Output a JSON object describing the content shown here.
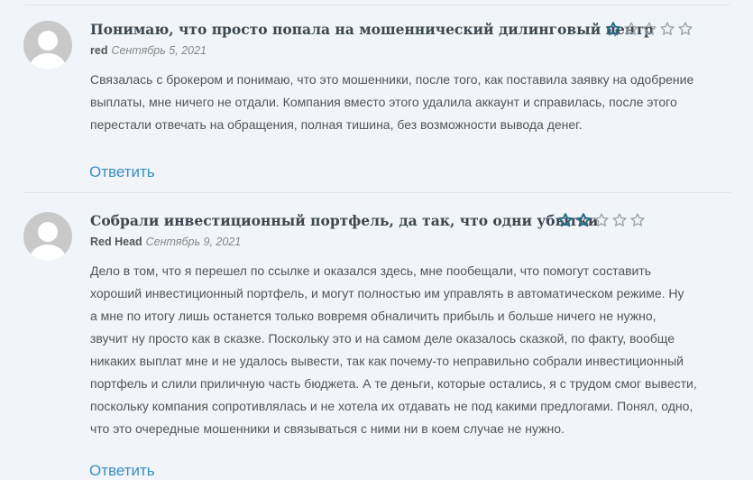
{
  "colors": {
    "star_filled": "#2a6c88",
    "star_empty": "#9aa4ae",
    "link": "#3a8fc0"
  },
  "comments": [
    {
      "title": "Понимаю, что просто попала на мошеннический дилинговый центр",
      "author": "red",
      "date": "Сентябрь 5, 2021",
      "rating": 1,
      "rating_max": 5,
      "lines": [
        "Связалась с брокером и понимаю, что это мошенники, после того, как поставила заявку на одобрение",
        "выплаты, мне ничего не отдали. Компания вместо этого удалила аккаунт и справилась, после этого",
        "перестали отвечать на обращения, полная тишина, без возможности вывода денег."
      ],
      "reply_label": "Ответить"
    },
    {
      "title": "Собрали инвестиционный портфель, да так, что одни убытки",
      "author": "Red Head",
      "date": "Сентябрь 9, 2021",
      "rating": 2,
      "rating_max": 5,
      "lines": [
        "Дело в том, что я перешел по ссылке и оказался здесь, мне пообещали, что помогут составить",
        "хороший инвестиционный портфель, и могут полностью им управлять в автоматическом режиме. Ну",
        "а мне по итогу лишь останется только вовремя обналичить прибыль и больше ничего не нужно,",
        "звучит ну просто как в сказке. Поскольку это и на самом деле оказалось сказкой, по факту, вообще",
        "никаких выплат мне и не удалось вывести, так как почему-то неправильно собрали инвестиционный",
        "портфель и слили приличную часть бюджета. А те деньги, которые остались, я с трудом смог вывести,",
        "поскольку компания сопротивлялась и не хотела их отдавать не под какими предлогами. Понял, одно,",
        "что это очередные мошенники и связываться с ними ни в коем случае не нужно."
      ],
      "reply_label": "Ответить"
    }
  ]
}
